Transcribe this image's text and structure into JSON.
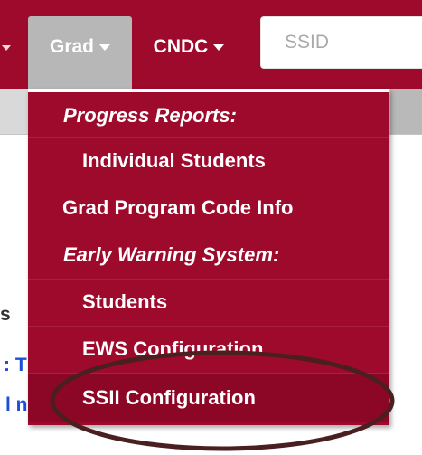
{
  "navbar": {
    "items": [
      {
        "label": "Grad"
      },
      {
        "label": "CNDC"
      }
    ],
    "search": {
      "placeholder": "SSID"
    }
  },
  "background_fragments": [
    "s",
    ": T",
    "l n"
  ],
  "dropdown": {
    "items": [
      {
        "label": "Progress Reports:"
      },
      {
        "label": "Individual Students"
      },
      {
        "label": "Grad Program Code Info"
      },
      {
        "label": "Early Warning System:"
      },
      {
        "label": "Students"
      },
      {
        "label": "EWS Configuration"
      },
      {
        "label": "SSII Configuration"
      }
    ]
  },
  "colors": {
    "navbar": "#9d0a2c",
    "active_tab": "#b7b7b7",
    "dropdown": "#9d0a2c",
    "highlight_ellipse": "#4a1f1f"
  }
}
